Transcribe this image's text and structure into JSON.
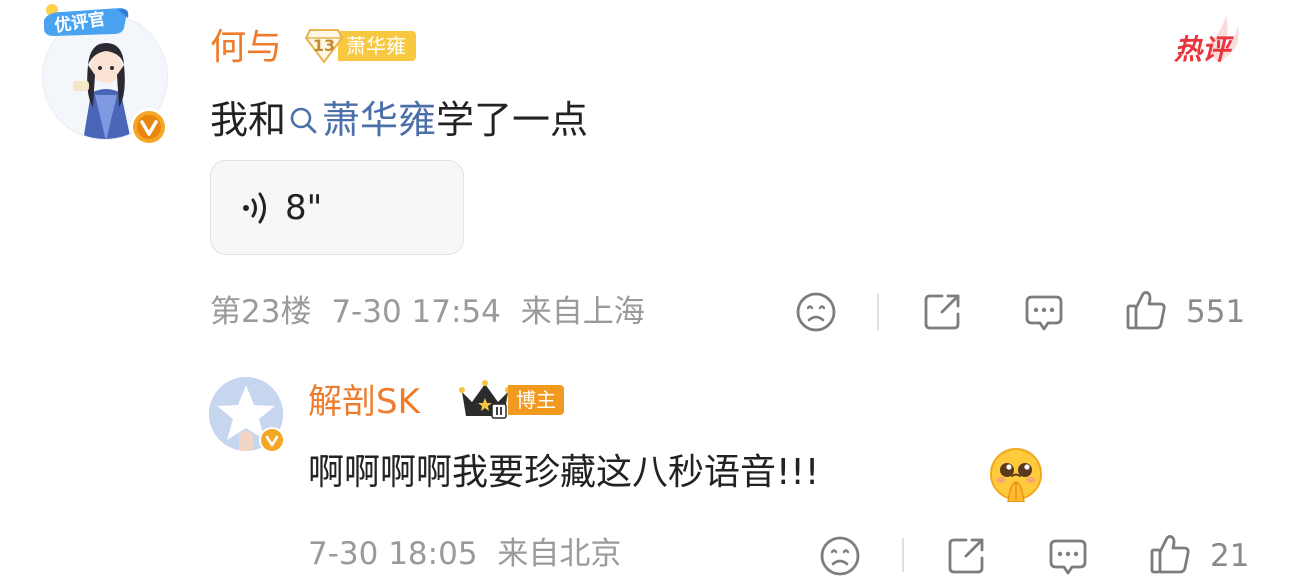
{
  "main_comment": {
    "author": "何与",
    "badge_youping": "优评官",
    "fan_level": "13",
    "fan_group": "萧华雍",
    "hot_label": "热评",
    "content_prefix": "我和",
    "mention": "萧华雍",
    "content_suffix": "学了一点",
    "voice_duration": "8\"",
    "floor": "第23楼",
    "time": "7-30 17:54",
    "location": "来自上海",
    "like_count": "551"
  },
  "reply": {
    "author": "解剖SK",
    "role_badge": "博主",
    "content": "啊啊啊啊我要珍藏这八秒语音!!!",
    "time": "7-30 18:05",
    "location": "来自北京",
    "like_count": "21"
  },
  "colors": {
    "username": "#ef7b2d",
    "mention": "#4b6fa8",
    "meta_text": "#9a9a9a",
    "hot": "#e8363f",
    "fan_badge": "#f7c840",
    "verify": "#f5a623"
  },
  "icons": {
    "dislike": "sad-face-icon",
    "share": "share-icon",
    "comment": "comment-icon",
    "like": "thumbs-up-icon",
    "voice": "sound-wave-icon",
    "search": "search-icon"
  }
}
